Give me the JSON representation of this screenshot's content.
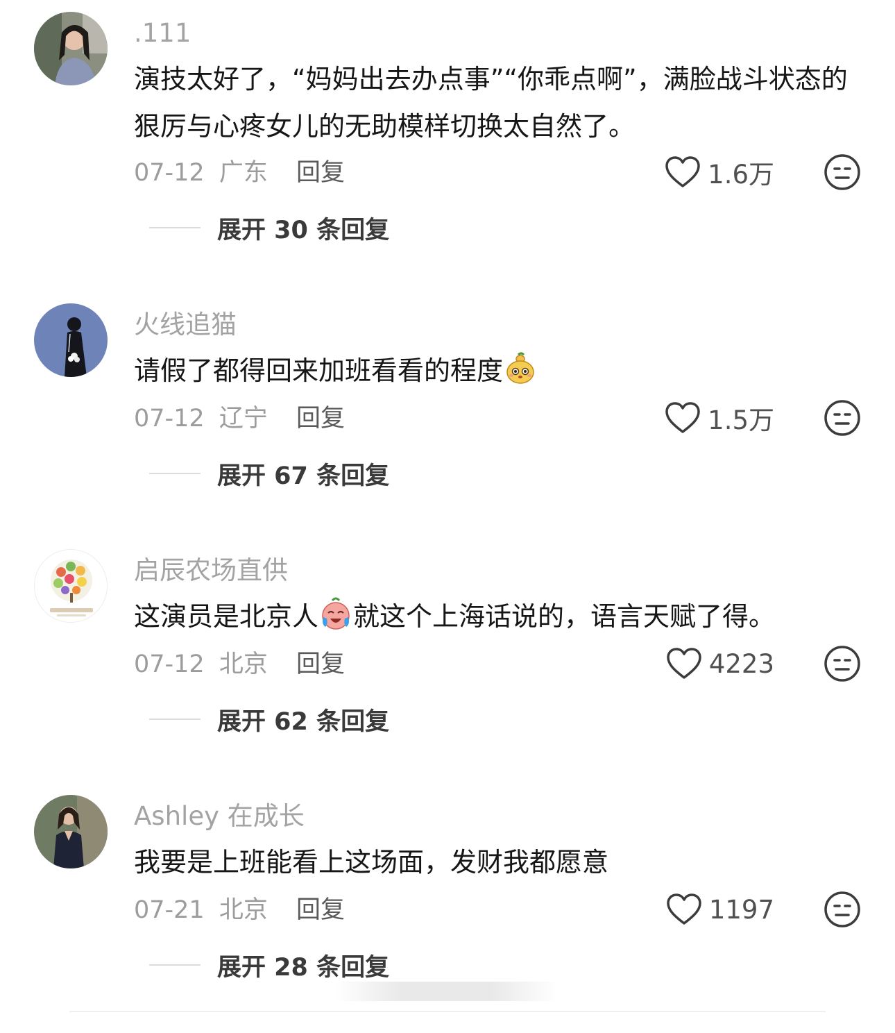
{
  "comments": [
    {
      "username": ".111",
      "text": "演技太好了，“妈妈出去办点事”“你乖点啊”，满脸战斗状态的狠厉与心疼女儿的无助模样切换太自然了。",
      "date": "07-12",
      "location": "广东",
      "reply_label": "回复",
      "likes": "1.6万",
      "expand_label": "展开 30 条回复"
    },
    {
      "username": "火线追猫",
      "text": "请假了都得回来加班看看的程度",
      "emoji": "gourd-face-emoji",
      "date": "07-12",
      "location": "辽宁",
      "reply_label": "回复",
      "likes": "1.5万",
      "expand_label": "展开 67 条回复"
    },
    {
      "username": "启辰农场直供",
      "text_before": "这演员是北京人",
      "emoji": "crying-laugh-emoji",
      "text_after": "就这个上海话说的，语言天赋了得。",
      "date": "07-12",
      "location": "北京",
      "reply_label": "回复",
      "likes": "4223",
      "expand_label": "展开 62 条回复"
    },
    {
      "username": "Ashley 在成长",
      "text": "我要是上班能看上这场面，发财我都愿意",
      "date": "07-21",
      "location": "北京",
      "reply_label": "回复",
      "likes": "1197",
      "expand_label": "展开 28 条回复"
    }
  ],
  "icons": {
    "like": "heart-outline-icon",
    "dislike": "meh-face-icon"
  },
  "colors": {
    "username": "#a3a3a3",
    "meta": "#9c9c9c",
    "text": "#161616"
  }
}
